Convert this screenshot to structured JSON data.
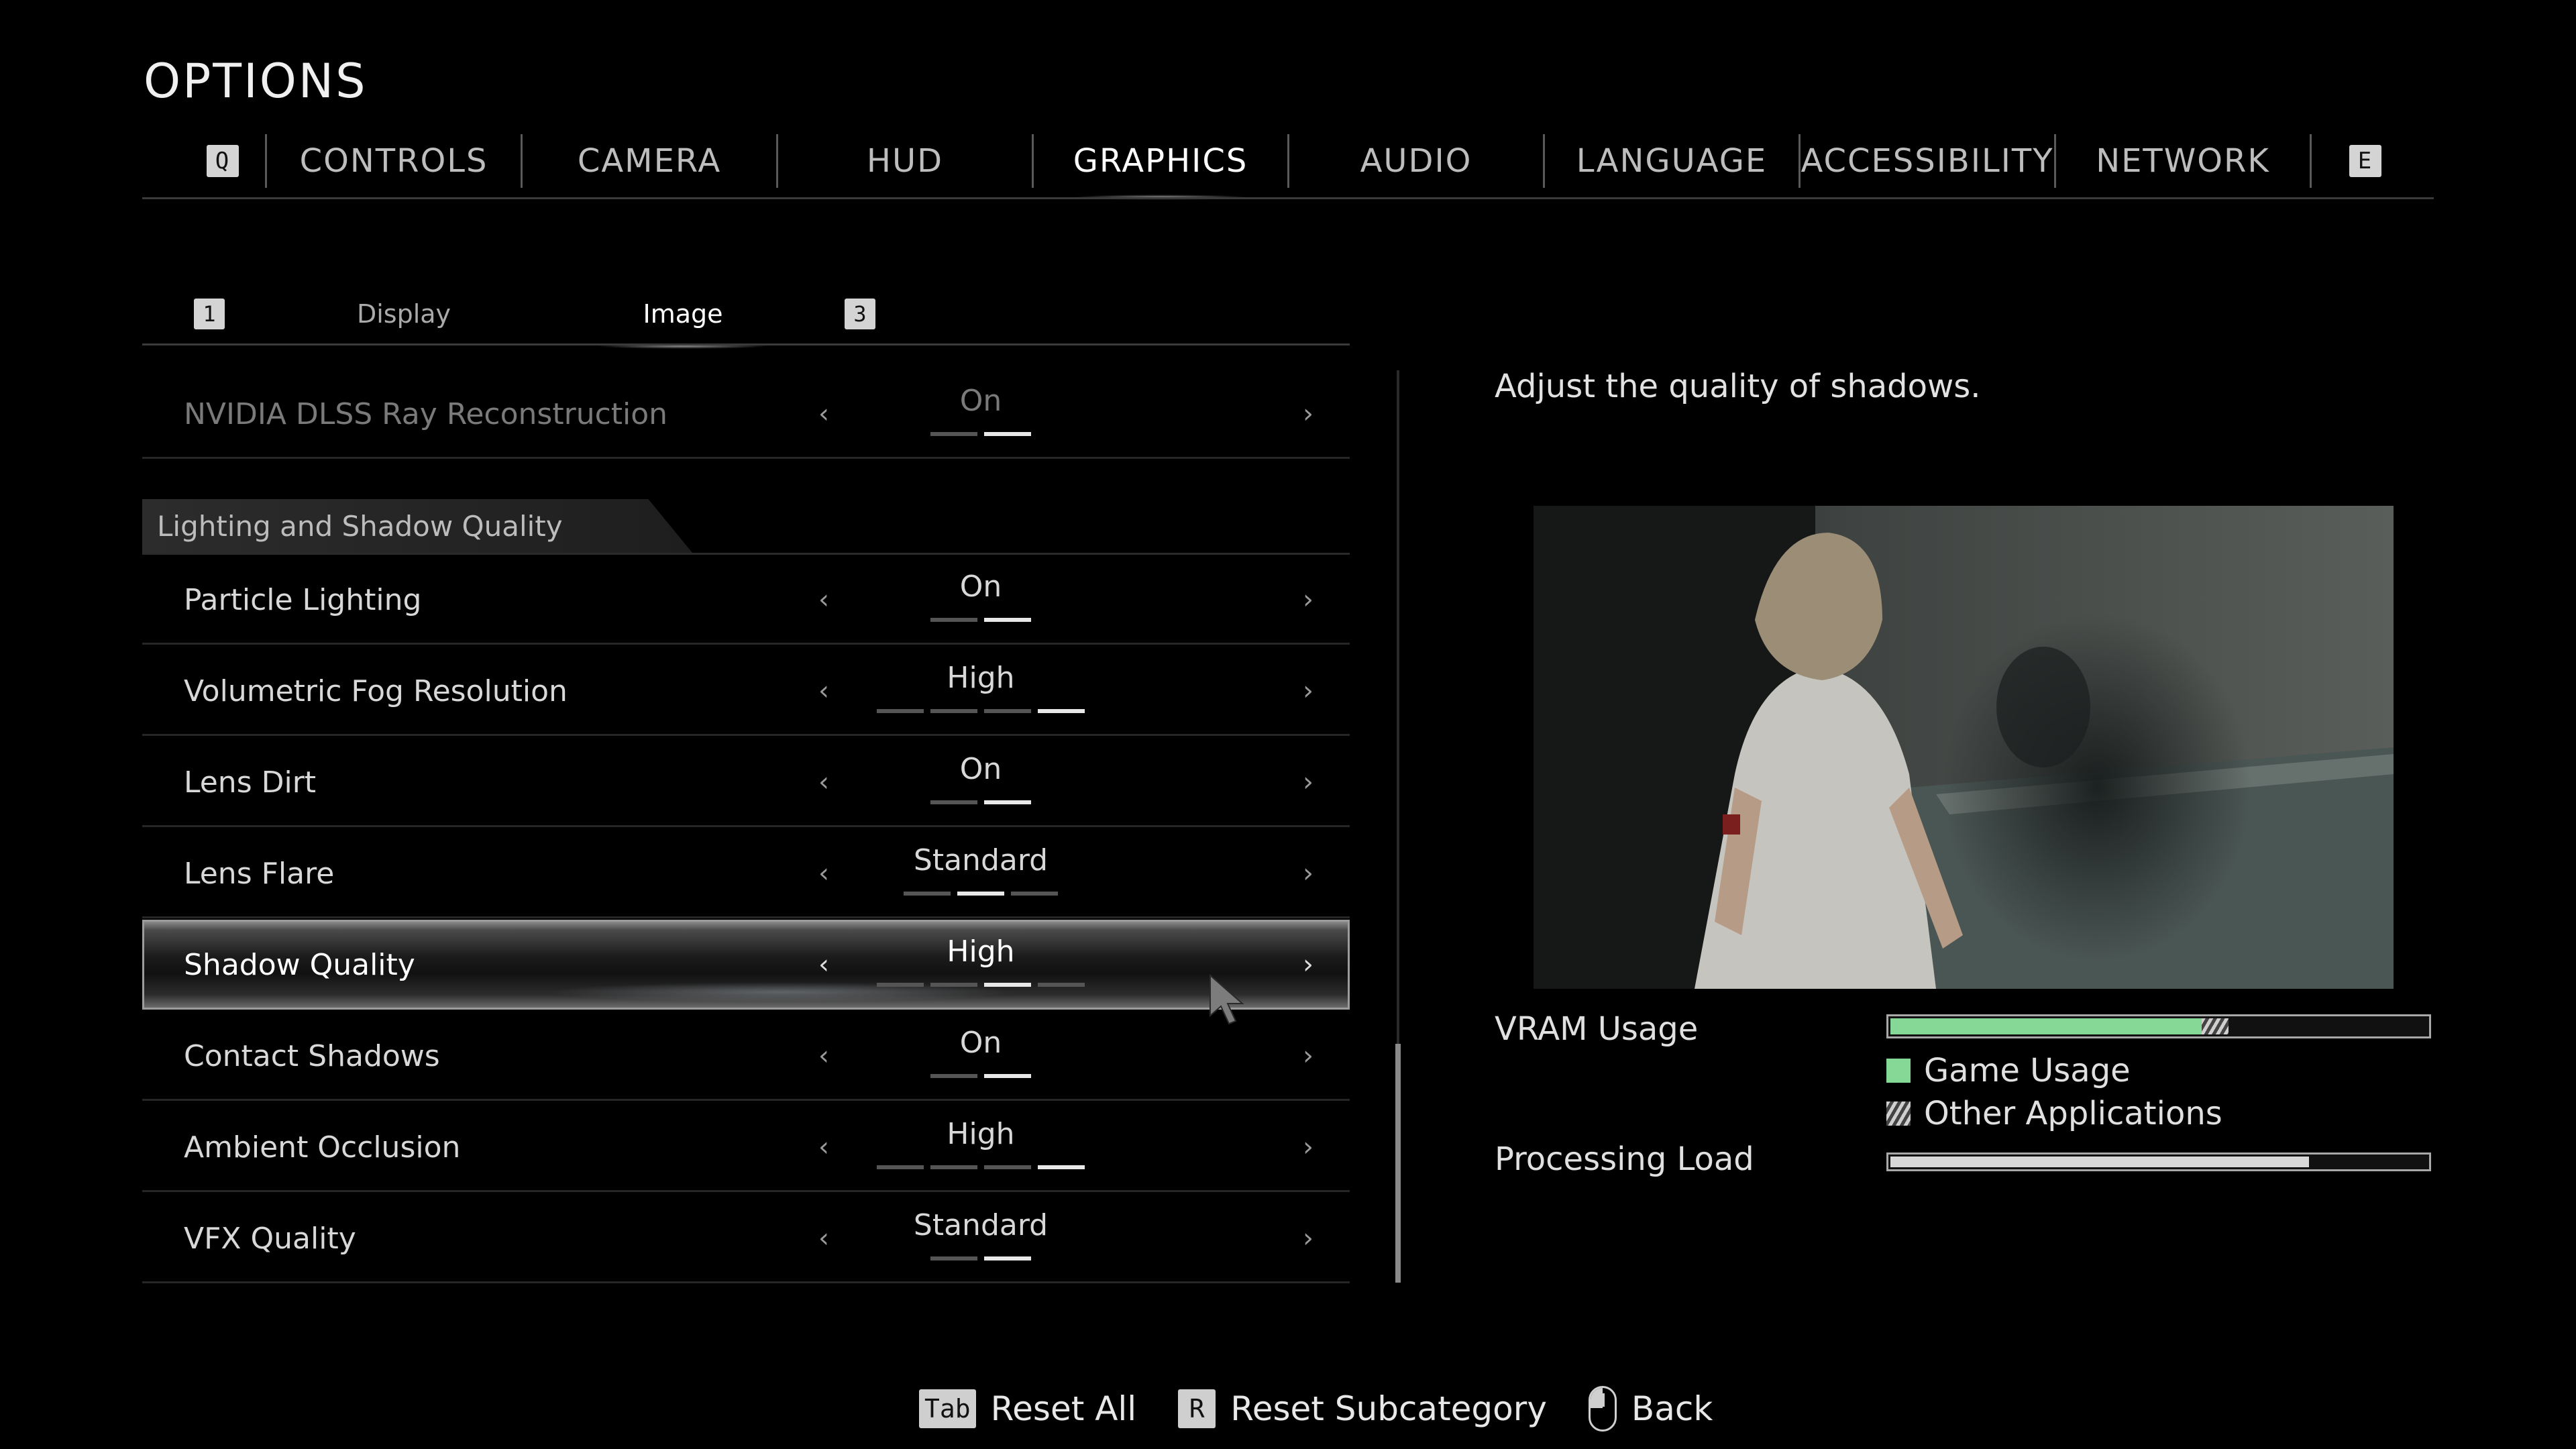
{
  "title": "OPTIONS",
  "tabs": {
    "prev_key": "Q",
    "next_key": "E",
    "items": [
      "CONTROLS",
      "CAMERA",
      "HUD",
      "GRAPHICS",
      "AUDIO",
      "LANGUAGE",
      "ACCESSIBILITY",
      "NETWORK"
    ],
    "active": "GRAPHICS"
  },
  "subtabs": {
    "prev_key": "1",
    "next_key": "3",
    "items": [
      "Display",
      "Image"
    ],
    "active": "Image"
  },
  "settings": {
    "dlss_rr": {
      "label": "NVIDIA DLSS Ray Reconstruction",
      "value": "On",
      "level": 2,
      "levels": 2,
      "disabled": true
    },
    "section_title": "Lighting and Shadow Quality",
    "particle_lighting": {
      "label": "Particle Lighting",
      "value": "On",
      "level": 2,
      "levels": 2
    },
    "volumetric_fog": {
      "label": "Volumetric Fog Resolution",
      "value": "High",
      "level": 4,
      "levels": 4
    },
    "lens_dirt": {
      "label": "Lens Dirt",
      "value": "On",
      "level": 2,
      "levels": 2
    },
    "lens_flare": {
      "label": "Lens Flare",
      "value": "Standard",
      "level": 2,
      "levels": 3
    },
    "shadow_quality": {
      "label": "Shadow Quality",
      "value": "High",
      "level": 3,
      "levels": 4,
      "selected": true
    },
    "contact_shadows": {
      "label": "Contact Shadows",
      "value": "On",
      "level": 2,
      "levels": 2
    },
    "ambient_occlusion": {
      "label": "Ambient Occlusion",
      "value": "High",
      "level": 4,
      "levels": 4
    },
    "vfx_quality": {
      "label": "VFX Quality",
      "value": "Standard",
      "level": 2,
      "levels": 2
    },
    "arrow_left": "‹",
    "arrow_right": "›"
  },
  "detail": {
    "description": "Adjust the quality of shadows.",
    "vram_label": "VRAM Usage",
    "vram_game_fraction": 0.58,
    "vram_other_fraction": 0.05,
    "legend_game": "Game Usage",
    "legend_other": "Other Applications",
    "processing_label": "Processing Load",
    "processing_fraction": 0.78,
    "colors": {
      "game": "#86d896",
      "other": "#bdbdbd"
    }
  },
  "footer": {
    "reset_all_key": "Tab",
    "reset_all": "Reset All",
    "reset_sub_key": "R",
    "reset_sub": "Reset Subcategory",
    "back": "Back"
  }
}
